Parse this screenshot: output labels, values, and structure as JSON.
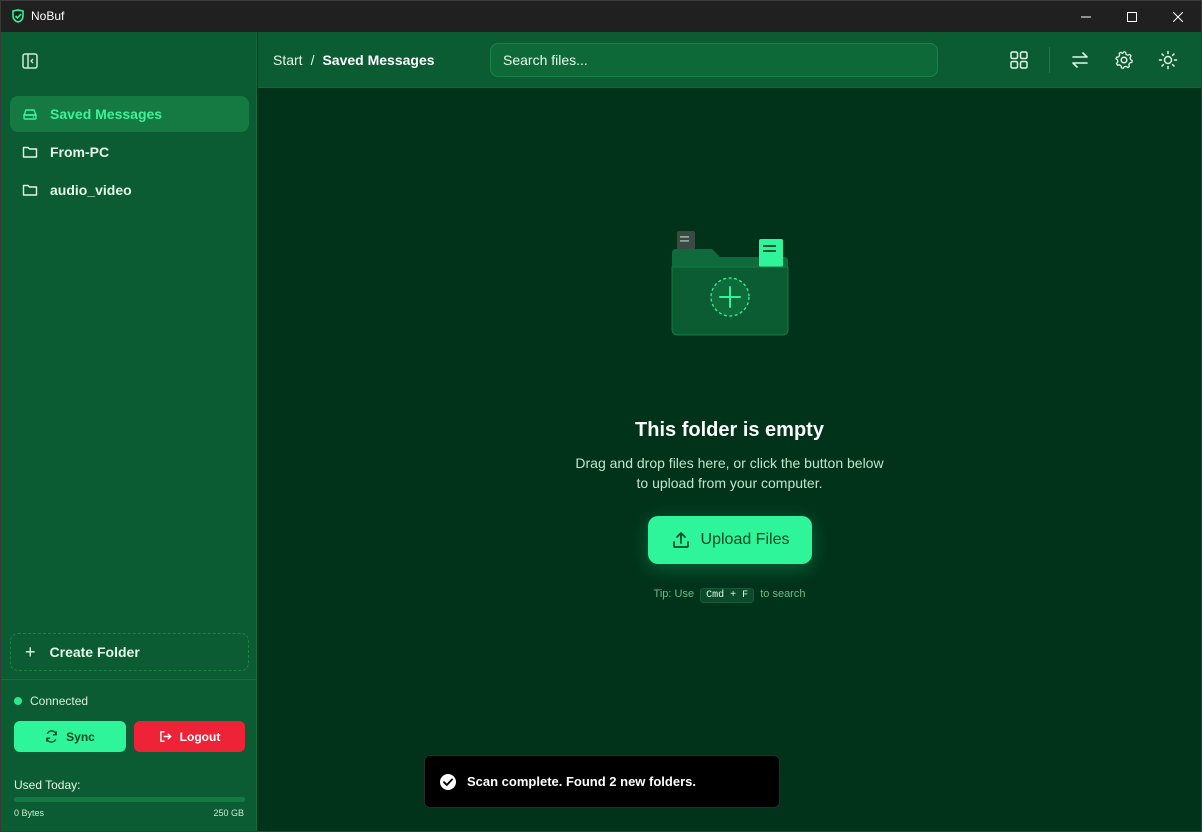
{
  "window": {
    "title": "NoBuf",
    "controls": [
      "minimize",
      "maximize",
      "close"
    ]
  },
  "sidebar": {
    "toggle_icon": "sidebar-collapse-icon",
    "items": [
      {
        "label": "Saved Messages",
        "icon": "drive-icon",
        "active": true
      },
      {
        "label": "From-PC",
        "icon": "folder-icon",
        "active": false
      },
      {
        "label": "audio_video",
        "icon": "folder-icon",
        "active": false
      }
    ],
    "create_folder_label": "Create Folder",
    "status_text": "Connected",
    "sync_label": "Sync",
    "logout_label": "Logout",
    "usage": {
      "label": "Used Today:",
      "used_text": "0 Bytes",
      "limit_text": "250 GB",
      "fraction": 0
    }
  },
  "header": {
    "breadcrumb": {
      "root": "Start",
      "separator": "/",
      "current": "Saved Messages"
    },
    "search_placeholder": "Search files...",
    "actions": [
      "grid-view-icon",
      "transfers-icon",
      "settings-icon",
      "theme-icon"
    ]
  },
  "empty_state": {
    "title": "This folder is empty",
    "desc_line1": "Drag and drop files here, or click the button below",
    "desc_line2": "to upload from your computer.",
    "upload_label": "Upload Files",
    "tip_prefix": "Tip: Use",
    "tip_key": "Cmd + F",
    "tip_suffix": "to search"
  },
  "toast": {
    "message": "Scan complete. Found 2 new folders."
  },
  "colors": {
    "accent": "#2ef59a",
    "sidebar_bg": "#0b5c32",
    "main_bg": "#00331a",
    "danger": "#ef2337"
  }
}
